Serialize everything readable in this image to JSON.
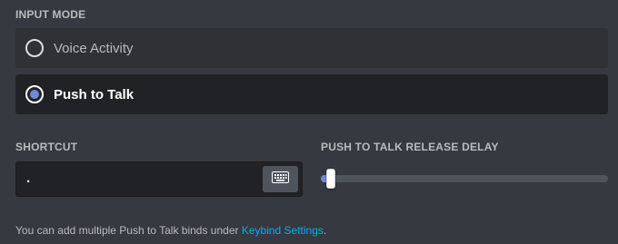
{
  "input_mode": {
    "label": "INPUT MODE",
    "options": [
      {
        "label": "Voice Activity",
        "selected": false
      },
      {
        "label": "Push to Talk",
        "selected": true
      }
    ]
  },
  "shortcut": {
    "label": "SHORTCUT",
    "value": "."
  },
  "release_delay": {
    "label": "PUSH TO TALK RELEASE DELAY",
    "value_fraction": 0.02
  },
  "help": {
    "prefix": "You can add multiple Push to Talk binds under ",
    "link": "Keybind Settings",
    "suffix": "."
  },
  "icons": {
    "shortcut_button": "keyboard-icon"
  },
  "colors": {
    "background": "#36393f",
    "accent": "#7289da",
    "link": "#00b0f4"
  }
}
